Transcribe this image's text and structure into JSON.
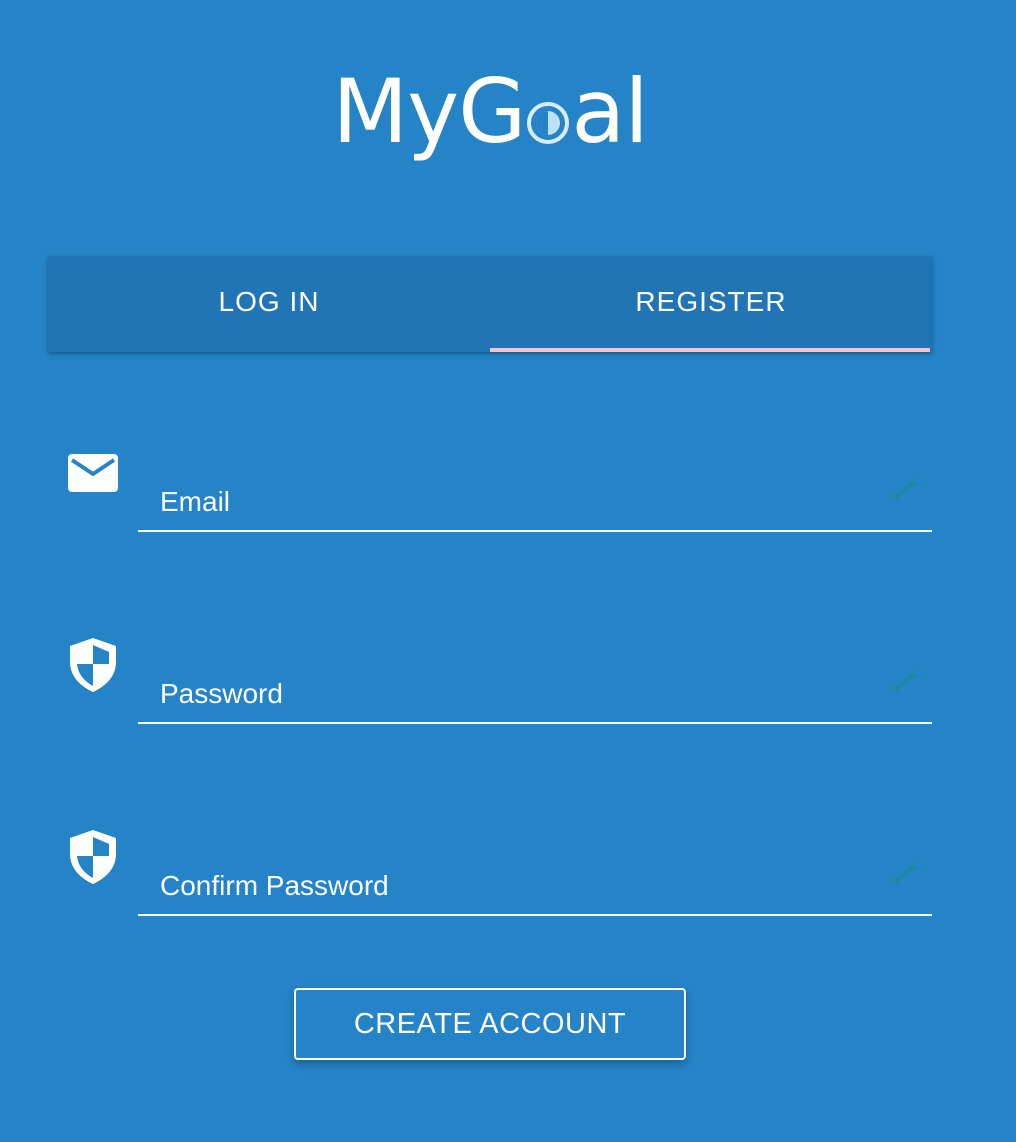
{
  "logo": {
    "text_before": "MyG",
    "text_after": "al",
    "full_text": "MyGoal"
  },
  "tabs": [
    {
      "label": "LOG IN",
      "active": false
    },
    {
      "label": "REGISTER",
      "active": true
    }
  ],
  "form": {
    "email": {
      "placeholder": "Email",
      "value": "",
      "icon": "envelope-icon"
    },
    "password": {
      "placeholder": "Password",
      "value": "",
      "icon": "shield-icon"
    },
    "confirm_password": {
      "placeholder": "Confirm Password",
      "value": "",
      "icon": "shield-icon"
    },
    "submit_label": "CREATE ACCOUNT"
  },
  "colors": {
    "background": "#2583c7",
    "tab_bar": "#2275b4",
    "tab_indicator": "#f3c3cf",
    "text": "#ffffff",
    "password_manager_icon": "#1c8a9c"
  }
}
